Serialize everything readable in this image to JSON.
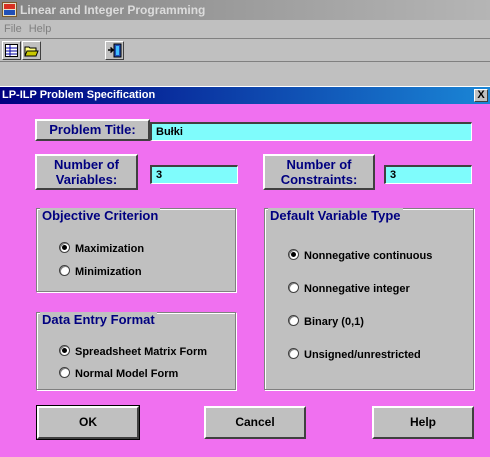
{
  "app": {
    "title": "Linear and Integer Programming",
    "menu": [
      "File",
      "Help"
    ]
  },
  "dialog": {
    "title": "LP-ILP Problem Specification",
    "close_glyph": "X",
    "problem_title_label": "Problem Title:",
    "problem_title_value": "Bułki",
    "num_variables_label": "Number of Variables:",
    "num_variables_value": "3",
    "num_constraints_label": "Number of Constraints:",
    "num_constraints_value": "3",
    "objective": {
      "title": "Objective Criterion",
      "options": [
        "Maximization",
        "Minimization"
      ],
      "selected": "Maximization"
    },
    "data_entry": {
      "title": "Data Entry Format",
      "options": [
        "Spreadsheet Matrix Form",
        "Normal Model Form"
      ],
      "selected": "Spreadsheet Matrix Form"
    },
    "variable_type": {
      "title": "Default Variable Type",
      "options": [
        "Nonnegative continuous",
        "Nonnegative integer",
        "Binary (0,1)",
        "Unsigned/unrestricted"
      ],
      "selected": "Nonnegative continuous"
    },
    "buttons": {
      "ok": "OK",
      "cancel": "Cancel",
      "help": "Help"
    }
  },
  "colors": {
    "dialog_bg": "#f070f0",
    "field_bg": "#7ffcfc",
    "label_text": "#000080"
  }
}
